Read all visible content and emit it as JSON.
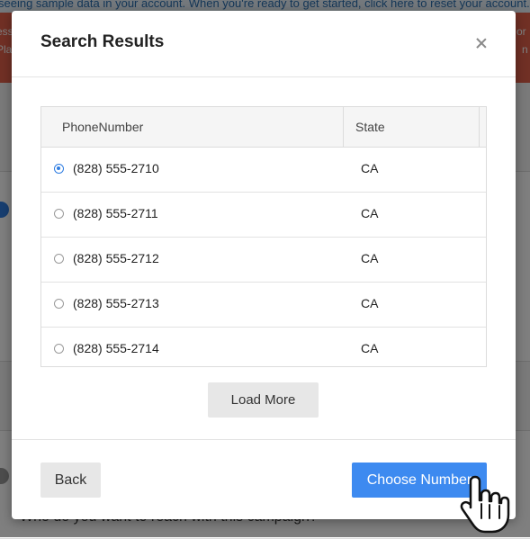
{
  "background": {
    "banner_text": "seeing sample data in your account. When you're ready to get started, click here to reset your account.",
    "alert_left_fragments": [
      "ess",
      "Pla"
    ],
    "alert_right_fragments": [
      "or",
      "n"
    ],
    "question_text": "Who do you want to reach with this campaign?"
  },
  "modal": {
    "title": "Search Results",
    "close_icon": "close-icon",
    "table": {
      "columns": [
        "PhoneNumber",
        "State"
      ],
      "rows": [
        {
          "phone": "(828) 555-2710",
          "state": "CA",
          "selected": true
        },
        {
          "phone": "(828) 555-2711",
          "state": "CA",
          "selected": false
        },
        {
          "phone": "(828) 555-2712",
          "state": "CA",
          "selected": false
        },
        {
          "phone": "(828) 555-2713",
          "state": "CA",
          "selected": false
        },
        {
          "phone": "(828) 555-2714",
          "state": "CA",
          "selected": false
        }
      ]
    },
    "load_more_label": "Load More",
    "back_label": "Back",
    "choose_label": "Choose Number"
  },
  "colors": {
    "primary": "#3d8af0",
    "alert": "#e2604a",
    "radio_selected": "#2f7de1"
  }
}
